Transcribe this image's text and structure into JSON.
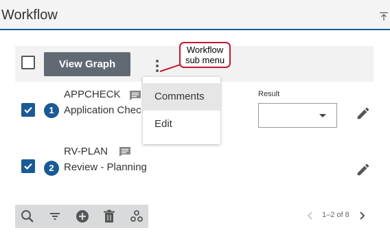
{
  "header": {
    "title": "Workflow",
    "collapse_icon": "collapse-top-icon"
  },
  "toolbar": {
    "view_graph_label": "View Graph",
    "more_icon": "kebab-icon"
  },
  "menu": {
    "items": [
      {
        "label": "Comments"
      },
      {
        "label": "Edit"
      }
    ]
  },
  "callout": {
    "line1": "Workflow",
    "line2": "sub menu"
  },
  "result": {
    "label": "Result",
    "value": ""
  },
  "rows": [
    {
      "number": "1",
      "code": "APPCHECK",
      "description": "Application Chec",
      "checked": true
    },
    {
      "number": "2",
      "code": "RV-PLAN",
      "description": "Review - Planning",
      "checked": true
    }
  ],
  "bottom_toolbar": {
    "icons": [
      "search-icon",
      "filter-icon",
      "add-circle-icon",
      "trash-icon",
      "settings-cluster-icon"
    ]
  },
  "pagination": {
    "text": "1–2 of 8"
  },
  "colors": {
    "accent": "#1a5a96",
    "button": "#616a73",
    "callout_border": "#c0182e"
  }
}
